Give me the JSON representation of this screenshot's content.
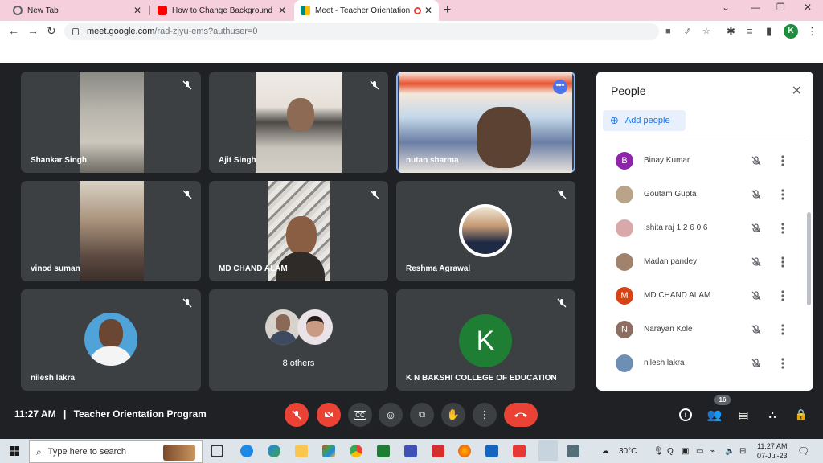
{
  "browser": {
    "tabs": [
      {
        "title": "New Tab",
        "favicon": "globe-icon",
        "color": "#5f6368"
      },
      {
        "title": "How to Change Background in G",
        "favicon": "youtube-icon",
        "color": "#ff0000"
      },
      {
        "title": "Meet - Teacher Orientation P",
        "favicon": "meet-icon",
        "color": "#00897b",
        "active": true
      }
    ],
    "url_host": "meet.google.com",
    "url_path": "/rad-zjyu-ems?authuser=0",
    "profile_initial": "K"
  },
  "tiles": [
    {
      "name": "Shankar Singh",
      "kind": "video",
      "muted": true
    },
    {
      "name": "Ajit Singh",
      "kind": "video",
      "muted": true
    },
    {
      "name": "nutan sharma",
      "kind": "video",
      "muted": false,
      "speaking": true
    },
    {
      "name": "vinod suman",
      "kind": "video",
      "muted": true
    },
    {
      "name": "MD CHAND ALAM",
      "kind": "video",
      "muted": true
    },
    {
      "name": "Reshma Agrawal",
      "kind": "avatar",
      "muted": true
    },
    {
      "name": "nilesh lakra",
      "kind": "avatar",
      "muted": true
    },
    {
      "name": "8 others",
      "kind": "group",
      "muted": false
    },
    {
      "name": "K N BAKSHI COLLEGE OF EDUCATION",
      "kind": "letter",
      "letter": "K",
      "muted": true
    }
  ],
  "meeting": {
    "time": "11:27 AM",
    "separator": "|",
    "title": "Teacher Orientation Program",
    "participant_count": "16"
  },
  "people_panel": {
    "title": "People",
    "add_label": "Add people",
    "people": [
      {
        "name": "Binay Kumar",
        "initial": "B",
        "color": "#8e24aa"
      },
      {
        "name": "Goutam Gupta",
        "initial": "",
        "color": "#b9a48a"
      },
      {
        "name": "Ishita raj 1 2 6 0 6",
        "initial": "",
        "color": "#d9a9a9"
      },
      {
        "name": "Madan pandey",
        "initial": "",
        "color": "#a0826d"
      },
      {
        "name": "MD CHAND ALAM",
        "initial": "M",
        "color": "#d84315"
      },
      {
        "name": "Narayan Kole",
        "initial": "N",
        "color": "#8d6e63"
      },
      {
        "name": "nilesh lakra",
        "initial": "",
        "color": "#6d8fb3"
      }
    ]
  },
  "taskbar": {
    "search_placeholder": "Type here to search",
    "weather": "30°C",
    "time": "11:27 AM",
    "date": "07-Jul-23"
  }
}
